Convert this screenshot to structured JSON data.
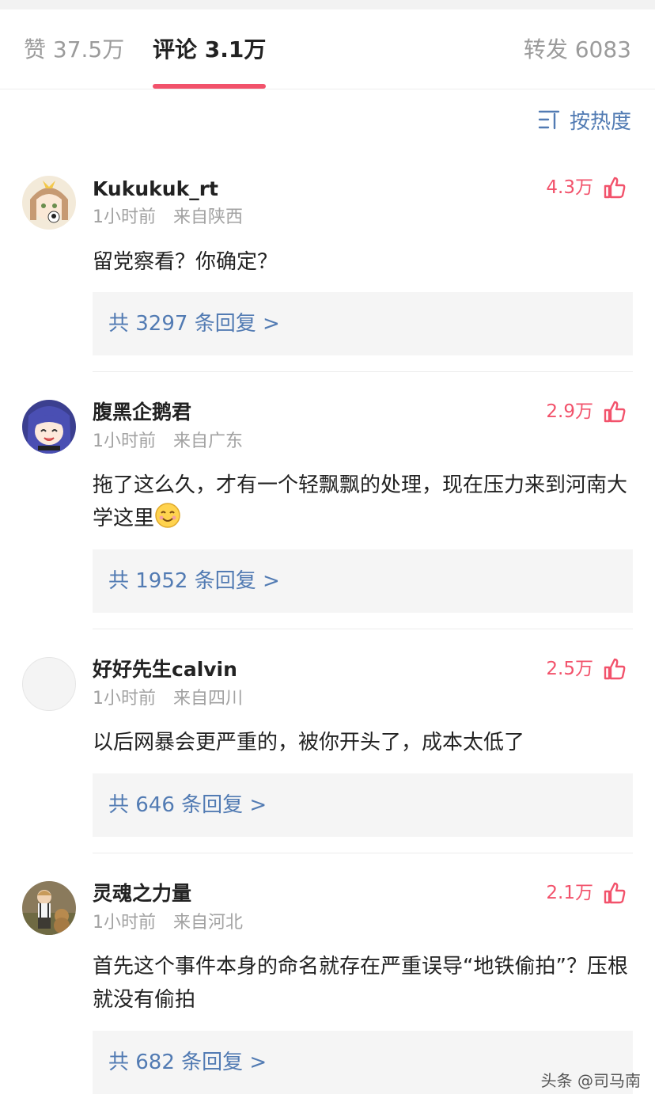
{
  "tabs": {
    "likes": "赞 37.5万",
    "comments": "评论 3.1万",
    "reposts": "转发 6083"
  },
  "sort": {
    "label": "按热度",
    "icon": "sort-icon"
  },
  "colors": {
    "accent": "#f2526b",
    "link": "#527bb3",
    "meta": "#a2a2a2"
  },
  "comments": [
    {
      "user": "Kukukuk_rt",
      "time": "1小时前",
      "location": "来自陕西",
      "likes": "4.3万",
      "text": "留党察看？你确定？",
      "replies": "共 3297 条回复 >"
    },
    {
      "user": "腹黑企鹅君",
      "time": "1小时前",
      "location": "来自广东",
      "likes": "2.9万",
      "text": "拖了这么久，才有一个轻飘飘的处理，现在压力来到河南大学这里",
      "replies": "共 1952 条回复 >"
    },
    {
      "user": "好好先生calvin",
      "time": "1小时前",
      "location": "来自四川",
      "likes": "2.5万",
      "text": "以后网暴会更严重的，被你开头了，成本太低了",
      "replies": "共 646 条回复 >"
    },
    {
      "user": "灵魂之力量",
      "time": "1小时前",
      "location": "来自河北",
      "likes": "2.1万",
      "text": "首先这个事件本身的命名就存在严重误导“地铁偷拍”？压根就没有偷拍",
      "replies": "共 682 条回复 >"
    }
  ],
  "watermark": "头条 @司马南"
}
